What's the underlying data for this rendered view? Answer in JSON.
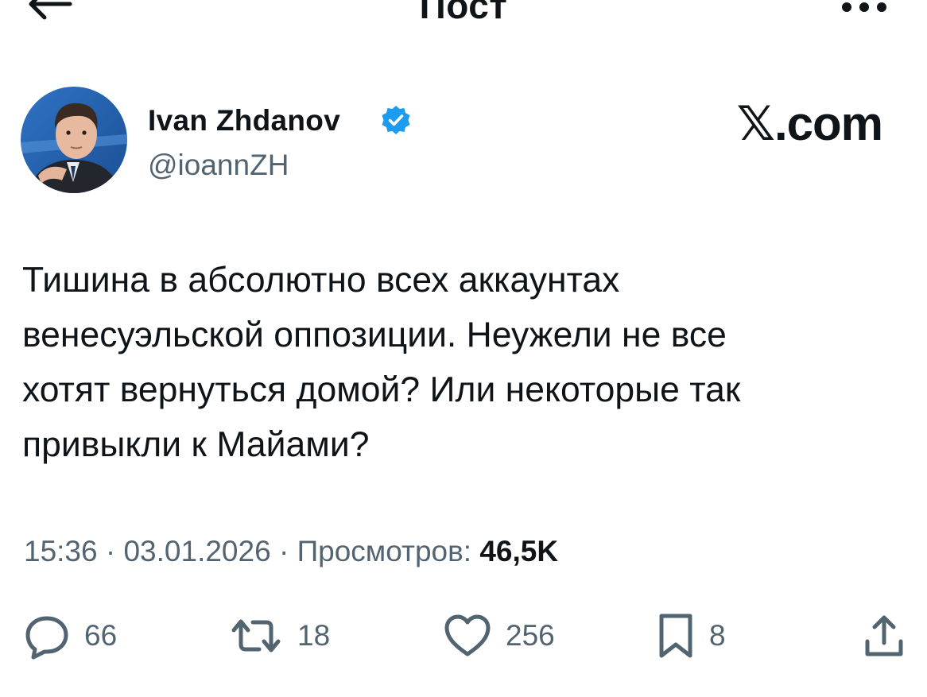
{
  "header": {
    "title": "Пост",
    "back_icon": "arrow-left-icon",
    "more_icon": "more-dots-icon"
  },
  "author": {
    "display_name": "Ivan Zhdanov",
    "handle": "@ioannZH",
    "verified": true,
    "verified_color": "#1d9bf0",
    "watermark": "𝕏.com"
  },
  "post": {
    "text": "Тишина в абсолютно всех аккаунтах\nвенесуэльской оппозиции. Неужели не все\nхотят вернуться домой? Или некоторые так\nпривыкли к Майами?",
    "time": "15:36",
    "date": "03.01.2026",
    "views_label": "Просмотров:",
    "views_count": "46,5K"
  },
  "actions": {
    "replies": "66",
    "reposts": "18",
    "likes": "256",
    "bookmarks": "8"
  },
  "colors": {
    "text": "#0f1419",
    "secondary": "#536471",
    "accent": "#1d9bf0"
  }
}
